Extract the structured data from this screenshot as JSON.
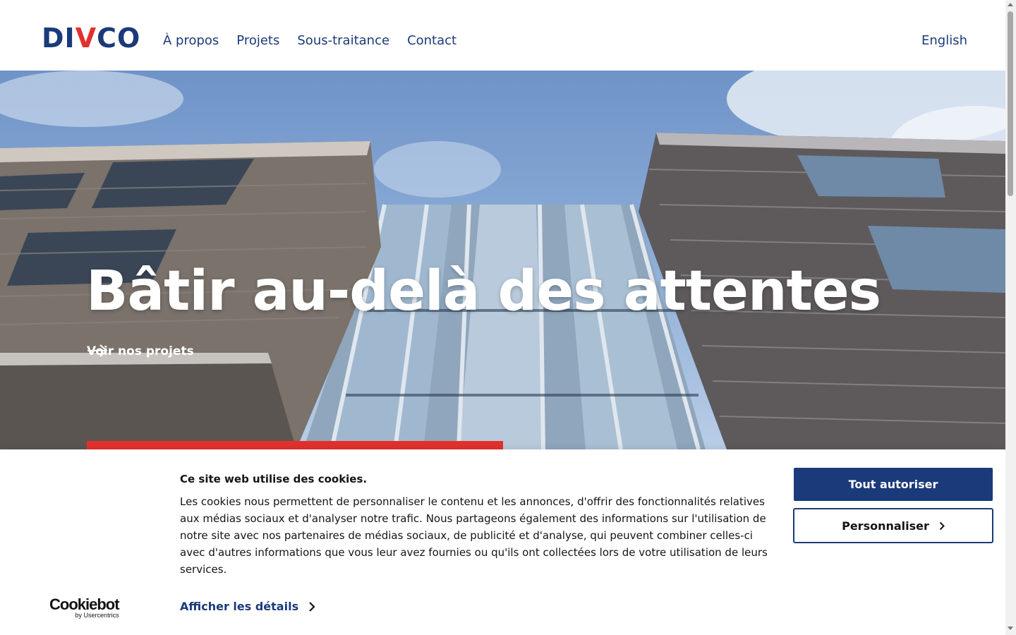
{
  "header": {
    "logo": {
      "prefix": "DI",
      "accent": "V",
      "suffix": "CO"
    },
    "nav": [
      {
        "label": "À propos"
      },
      {
        "label": "Projets"
      },
      {
        "label": "Sous-traitance"
      },
      {
        "label": "Contact"
      }
    ],
    "language": "English"
  },
  "hero": {
    "title": "Bâtir au-delà des attentes",
    "link_label": "Voir nos projets",
    "link_icon": "arrow-right-icon"
  },
  "cookie_banner": {
    "title": "Ce site web utilise des cookies.",
    "text": "Les cookies nous permettent de personnaliser le contenu et les annonces, d'offrir des fonctionnalités relatives aux médias sociaux et d'analyser notre trafic. Nous partageons également des informations sur l'utilisation de notre site avec nos partenaires de médias sociaux, de publicité et d'analyse, qui peuvent combiner celles-ci avec d'autres informations que vous leur avez fournies ou qu'ils ont collectées lors de votre utilisation de leurs services.",
    "details_label": "Afficher les détails",
    "allow_all_label": "Tout autoriser",
    "customize_label": "Personnaliser",
    "brand": "Cookiebot",
    "brand_sub": "by Usercentrics"
  },
  "colors": {
    "brand_blue": "#1b3a7a",
    "brand_red": "#e2312d"
  }
}
